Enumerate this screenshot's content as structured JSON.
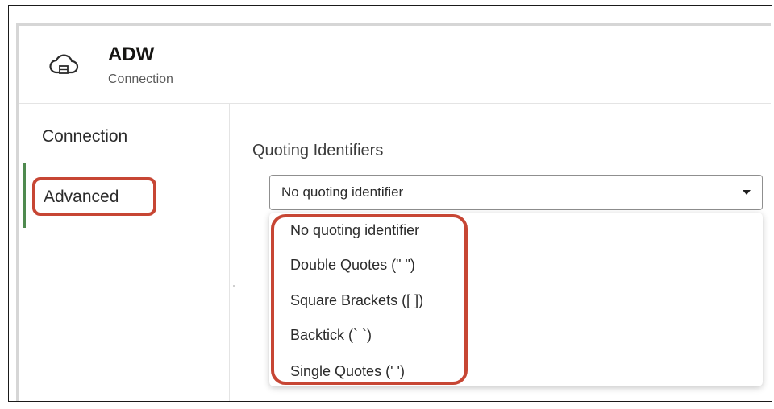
{
  "header": {
    "title": "ADW",
    "subtitle": "Connection",
    "icon": "cloud-database-icon"
  },
  "sidebar": {
    "items": [
      {
        "label": "Connection",
        "active": false
      },
      {
        "label": "Advanced",
        "active": true
      }
    ],
    "active_color": "#4f8a4f"
  },
  "main": {
    "field_label": "Quoting Identifiers",
    "select": {
      "value": "No quoting identifier",
      "options": [
        "No quoting identifier",
        "Double Quotes (\" \")",
        "Square Brackets ([ ])",
        "Backtick (` `)",
        "Single Quotes (' ')"
      ]
    }
  },
  "annotation_color": "#c74634"
}
